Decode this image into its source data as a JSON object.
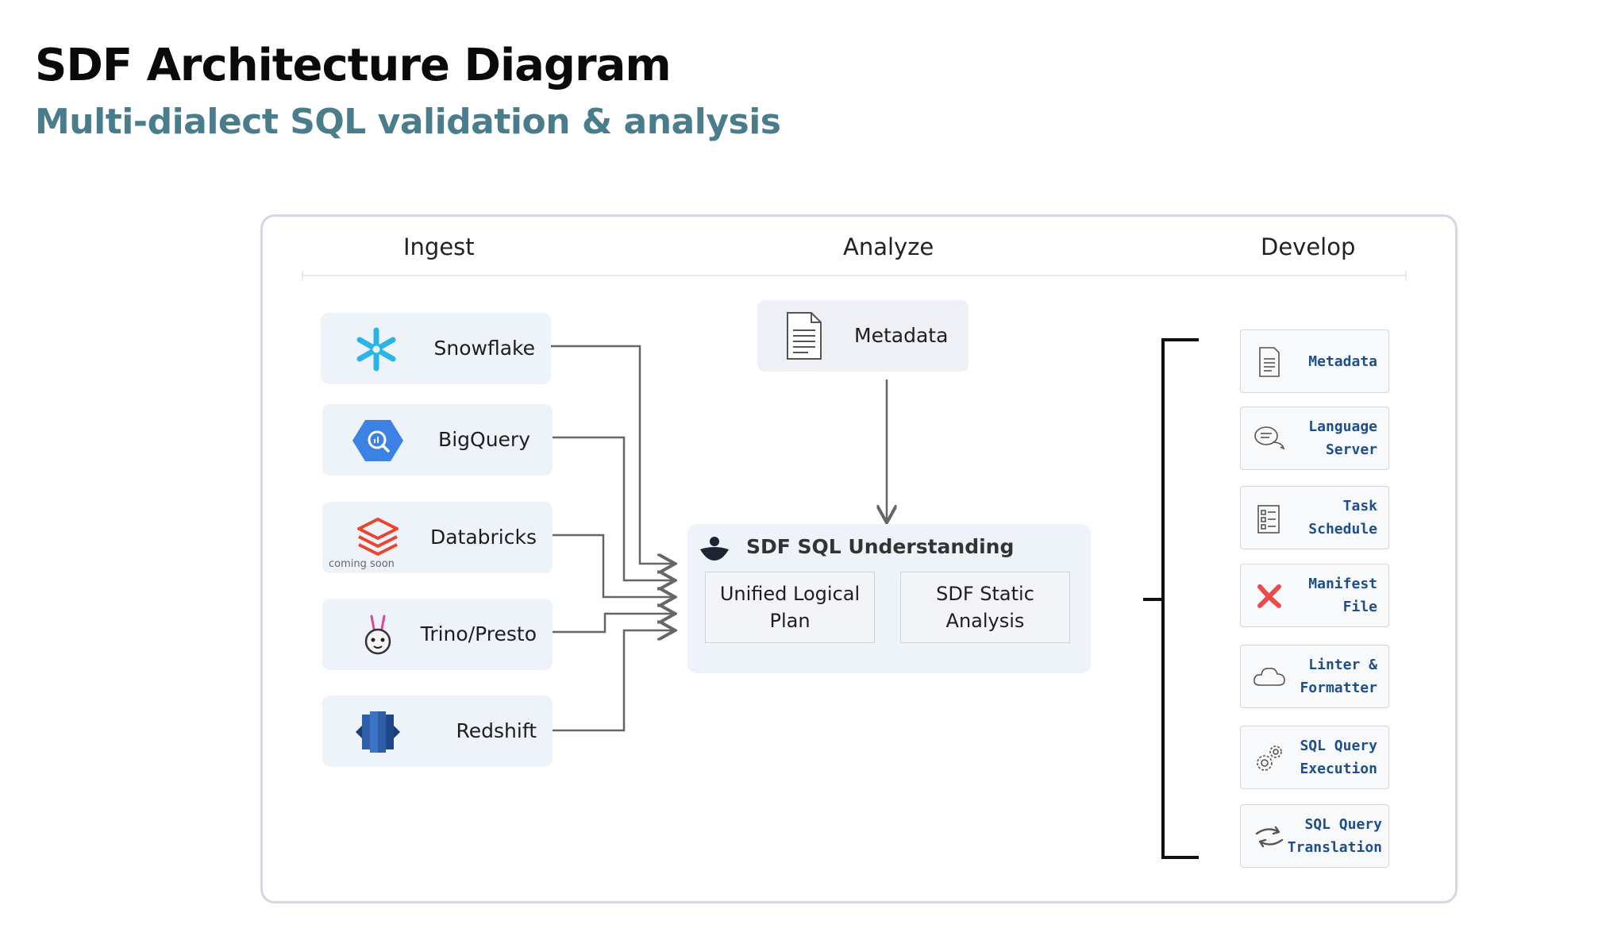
{
  "header": {
    "title": "SDF Architecture Diagram",
    "subtitle": "Multi-dialect SQL validation & analysis"
  },
  "columns": {
    "ingest": "Ingest",
    "analyze": "Analyze",
    "develop": "Develop"
  },
  "sources": [
    {
      "label": "Snowflake",
      "icon": "snowflake-icon"
    },
    {
      "label": "BigQuery",
      "icon": "bigquery-icon"
    },
    {
      "label": "Databricks",
      "icon": "databricks-icon",
      "note": "coming soon"
    },
    {
      "label": "Trino/Presto",
      "icon": "trino-icon"
    },
    {
      "label": "Redshift",
      "icon": "redshift-icon"
    }
  ],
  "analyze": {
    "metadata_label": "Metadata",
    "sdf_title": "SDF SQL Understanding",
    "inner_left": "Unified Logical Plan",
    "inner_right": "SDF Static Analysis"
  },
  "develop": [
    {
      "label": "Metadata",
      "icon": "document-icon"
    },
    {
      "label": "Language Server",
      "icon": "chat-icon"
    },
    {
      "label": "Task Schedule",
      "icon": "checklist-icon"
    },
    {
      "label": "Manifest File",
      "icon": "manifest-icon"
    },
    {
      "label": "Linter & Formatter",
      "icon": "cloud-icon"
    },
    {
      "label": "SQL Query Execution",
      "icon": "gears-icon"
    },
    {
      "label": "SQL Query Translation",
      "icon": "refresh-icon"
    }
  ],
  "colors": {
    "subtitle": "#4a7d8c",
    "source_bg": "#eef3fa",
    "develop_text": "#1f4f8a",
    "connector": "#666666"
  }
}
